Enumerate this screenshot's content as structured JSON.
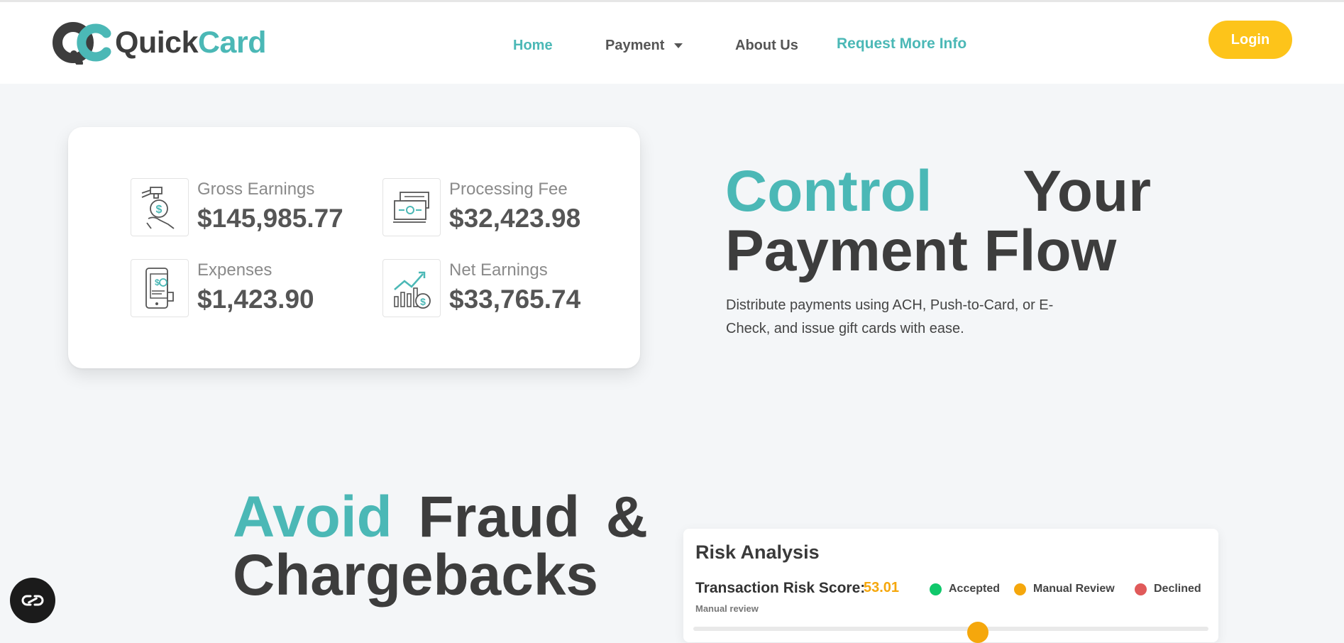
{
  "brand": {
    "quick": "Quick",
    "card": "Card",
    "teal": "#4bb8b6",
    "accent": "#fdc41a"
  },
  "nav": {
    "home": "Home",
    "payment": "Payment",
    "about": "About Us",
    "request": "Request More Info",
    "login": "Login"
  },
  "stats": [
    {
      "label": "Gross Earnings",
      "value": "$145,985.77",
      "icon": "money-bag-hand-icon"
    },
    {
      "label": "Processing Fee",
      "value": "$32,423.98",
      "icon": "cash-stack-icon"
    },
    {
      "label": "Expenses",
      "value": "$1,423.90",
      "icon": "phone-receipt-icon"
    },
    {
      "label": "Net Earnings",
      "value": "$33,765.74",
      "icon": "growth-chart-dollar-icon"
    }
  ],
  "hero": {
    "word1": "Control",
    "word2": "Your",
    "line2": "Payment Flow",
    "description": "Distribute payments using ACH, Push-to-Card, or E-Check, and issue gift cards with ease."
  },
  "fraud": {
    "word1": "Avoid",
    "word2": "Fraud",
    "word3": "&",
    "line2": "Chargebacks"
  },
  "risk": {
    "title": "Risk Analysis",
    "score_label": "Transaction Risk Score:",
    "score_value": "53.01",
    "sub_label": "Manual review",
    "legend": [
      {
        "label": "Accepted",
        "color": "#10c86b"
      },
      {
        "label": "Manual Review",
        "color": "#f5a70c"
      },
      {
        "label": "Declined",
        "color": "#e05a5a"
      }
    ]
  },
  "fab": {
    "icon": "accessibility-icon"
  }
}
